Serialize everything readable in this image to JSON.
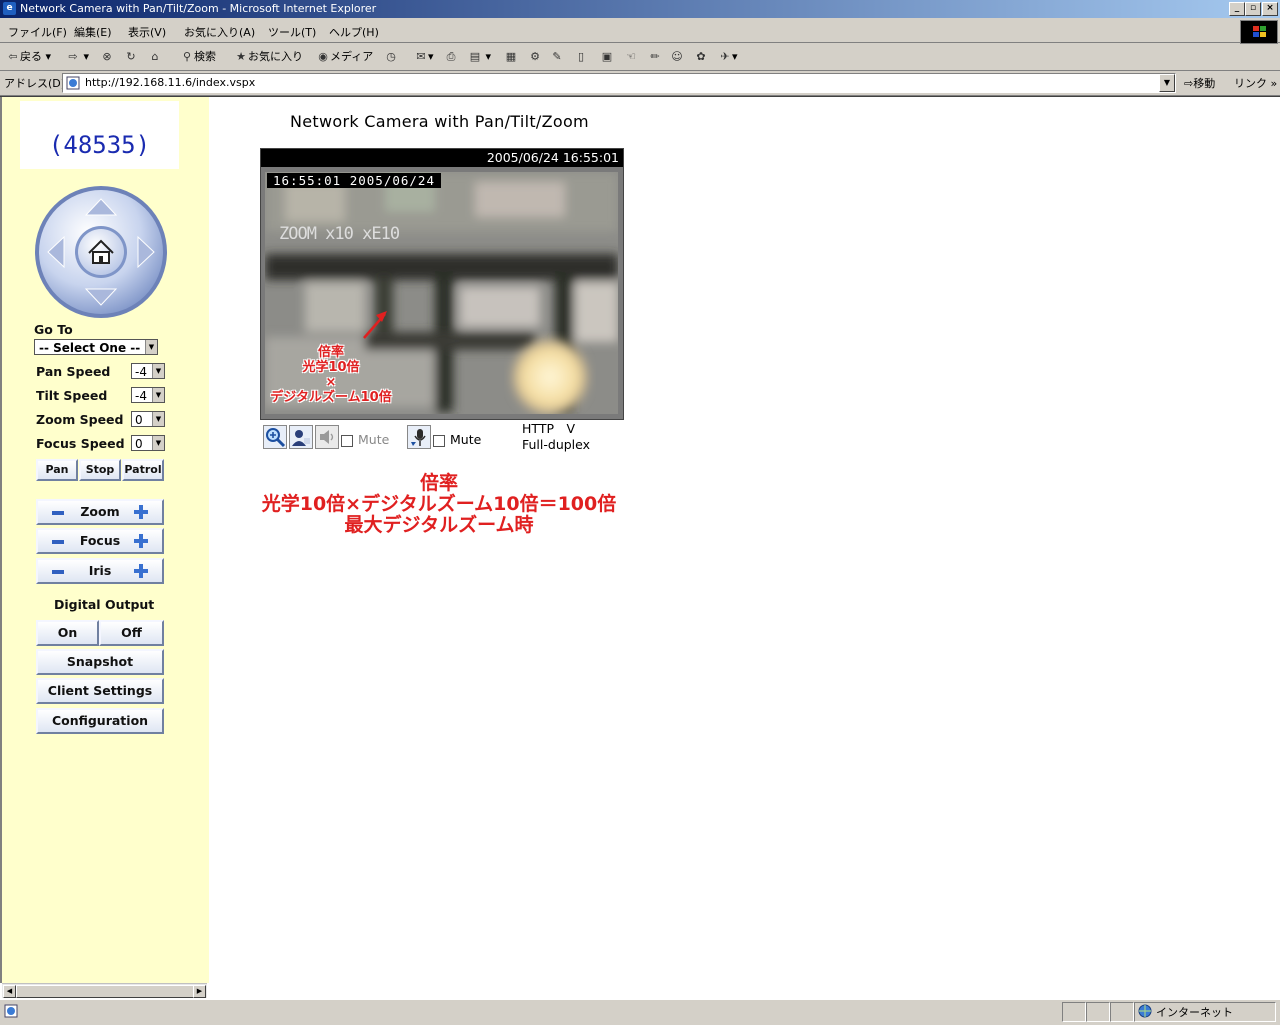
{
  "window": {
    "title": "Network Camera with Pan/Tilt/Zoom - Microsoft Internet Explorer"
  },
  "menu": [
    "ファイル(F)",
    "編集(E)",
    "表示(V)",
    "お気に入り(A)",
    "ツール(T)",
    "ヘルプ(H)"
  ],
  "toolbar": {
    "back": "戻る",
    "search": "検索",
    "favorites": "お気に入り",
    "media": "メディア"
  },
  "address": {
    "label": "アドレス(D)",
    "url": "http://192.168.11.6/index.vspx",
    "go": "移動",
    "links": "リンク"
  },
  "sidebar": {
    "camera_id": "(48535)",
    "goto_label": "Go To",
    "goto_value": "-- Select One --",
    "speeds": [
      {
        "label": "Pan Speed",
        "value": "-4"
      },
      {
        "label": "Tilt Speed",
        "value": "-4"
      },
      {
        "label": "Zoom Speed",
        "value": "0"
      },
      {
        "label": "Focus Speed",
        "value": "0"
      }
    ],
    "mode_buttons": [
      "Pan",
      "Stop",
      "Patrol"
    ],
    "adjust": [
      "Zoom",
      "Focus",
      "Iris"
    ],
    "digital_output_label": "Digital Output",
    "on": "On",
    "off": "Off",
    "snapshot": "Snapshot",
    "client_settings": "Client Settings",
    "configuration": "Configuration"
  },
  "main": {
    "title": "Network Camera with Pan/Tilt/Zoom",
    "header_time": "2005/06/24 16:55:01",
    "stamp": "16:55:01  2005/06/24",
    "zoom_overlay": "ZOOM x10 xE10",
    "annotation": [
      "倍率",
      "光学10倍",
      "×",
      "デジタルズーム10倍"
    ],
    "mute1": "Mute",
    "mute2": "Mute",
    "protocol": "HTTP　V",
    "duplex": "Full-duplex",
    "note": [
      "倍率",
      "光学10倍×デジタルズーム10倍＝100倍",
      "最大デジタルズーム時"
    ]
  },
  "status": {
    "zone": "インターネット"
  },
  "colors": {
    "sidebar_bg": "#ffffcc",
    "annotation_red": "#e02020",
    "camid_blue": "#1a2bb0"
  }
}
